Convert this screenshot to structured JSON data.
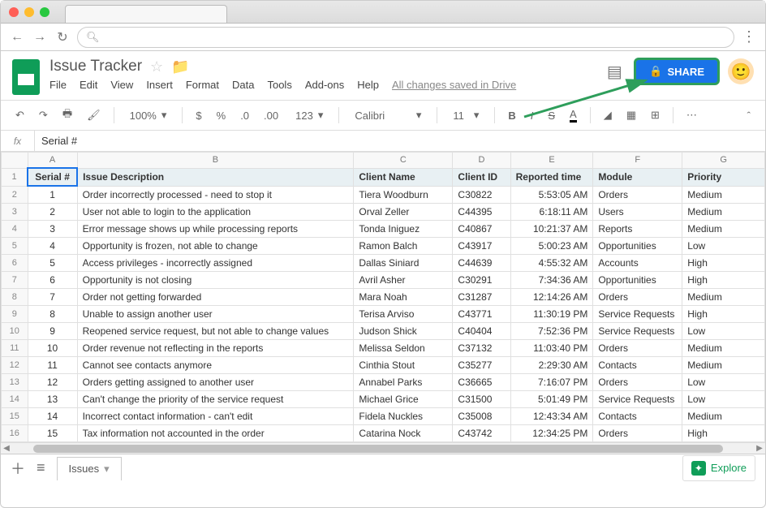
{
  "browser": {
    "url_placeholder": ""
  },
  "doc": {
    "title": "Issue Tracker",
    "menus": [
      "File",
      "Edit",
      "View",
      "Insert",
      "Format",
      "Data",
      "Tools",
      "Add-ons",
      "Help"
    ],
    "save_status": "All changes saved in Drive",
    "share_label": "SHARE"
  },
  "toolbar": {
    "zoom": "100%",
    "font": "Calibri",
    "font_size": "11",
    "more_formats": "123"
  },
  "formula": {
    "label": "fx",
    "value": "Serial #"
  },
  "columns": [
    "",
    "A",
    "B",
    "C",
    "D",
    "E",
    "F",
    "G"
  ],
  "headers": {
    "serial": "Serial #",
    "desc": "Issue Description",
    "client": "Client Name",
    "id": "Client ID",
    "time": "Reported time",
    "module": "Module",
    "priority": "Priority"
  },
  "rows": [
    {
      "n": 1,
      "desc": "Order incorrectly processed - need to stop it",
      "client": "Tiera Woodburn",
      "id": "C30822",
      "time": "5:53:05 AM",
      "module": "Orders",
      "priority": "Medium"
    },
    {
      "n": 2,
      "desc": "User not able to login to the application",
      "client": "Orval Zeller",
      "id": "C44395",
      "time": "6:18:11 AM",
      "module": "Users",
      "priority": "Medium"
    },
    {
      "n": 3,
      "desc": "Error message shows up while processing reports",
      "client": "Tonda Iniguez",
      "id": "C40867",
      "time": "10:21:37 AM",
      "module": "Reports",
      "priority": "Medium"
    },
    {
      "n": 4,
      "desc": "Opportunity is frozen, not able to change",
      "client": "Ramon Balch",
      "id": "C43917",
      "time": "5:00:23 AM",
      "module": "Opportunities",
      "priority": "Low"
    },
    {
      "n": 5,
      "desc": "Access privileges - incorrectly assigned",
      "client": "Dallas Siniard",
      "id": "C44639",
      "time": "4:55:32 AM",
      "module": "Accounts",
      "priority": "High"
    },
    {
      "n": 6,
      "desc": "Opportunity is not closing",
      "client": "Avril Asher",
      "id": "C30291",
      "time": "7:34:36 AM",
      "module": "Opportunities",
      "priority": "High"
    },
    {
      "n": 7,
      "desc": "Order not getting forwarded",
      "client": "Mara Noah",
      "id": "C31287",
      "time": "12:14:26 AM",
      "module": "Orders",
      "priority": "Medium"
    },
    {
      "n": 8,
      "desc": "Unable to assign another user",
      "client": "Terisa Arviso",
      "id": "C43771",
      "time": "11:30:19 PM",
      "module": "Service Requests",
      "priority": "High"
    },
    {
      "n": 9,
      "desc": "Reopened service request, but not able to change values",
      "client": "Judson Shick",
      "id": "C40404",
      "time": "7:52:36 PM",
      "module": "Service Requests",
      "priority": "Low"
    },
    {
      "n": 10,
      "desc": "Order revenue not reflecting in the reports",
      "client": "Melissa Seldon",
      "id": "C37132",
      "time": "11:03:40 PM",
      "module": "Orders",
      "priority": "Medium"
    },
    {
      "n": 11,
      "desc": "Cannot see contacts anymore",
      "client": "Cinthia Stout",
      "id": "C35277",
      "time": "2:29:30 AM",
      "module": "Contacts",
      "priority": "Medium"
    },
    {
      "n": 12,
      "desc": "Orders getting assigned to another user",
      "client": "Annabel Parks",
      "id": "C36665",
      "time": "7:16:07 PM",
      "module": "Orders",
      "priority": "Low"
    },
    {
      "n": 13,
      "desc": "Can't change the priority of the service request",
      "client": "Michael Grice",
      "id": "C31500",
      "time": "5:01:49 PM",
      "module": "Service Requests",
      "priority": "Low"
    },
    {
      "n": 14,
      "desc": "Incorrect contact information - can't edit",
      "client": "Fidela Nuckles",
      "id": "C35008",
      "time": "12:43:34 AM",
      "module": "Contacts",
      "priority": "Medium"
    },
    {
      "n": 15,
      "desc": "Tax information not accounted in the order",
      "client": "Catarina Nock",
      "id": "C43742",
      "time": "12:34:25 PM",
      "module": "Orders",
      "priority": "High"
    }
  ],
  "sheet_tab": "Issues",
  "explore_label": "Explore"
}
